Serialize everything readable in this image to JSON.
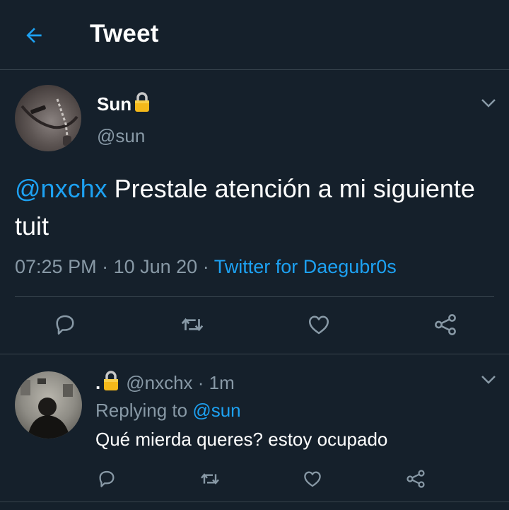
{
  "header": {
    "title": "Tweet",
    "back_icon": "arrow-left-icon"
  },
  "colors": {
    "background": "#15202b",
    "accent": "#1da1f2",
    "muted": "#8899a6",
    "divider": "#38444d"
  },
  "tweet": {
    "name": "Sun",
    "handle": "@sun",
    "mention": "@nxchx",
    "text": " Prestale atención a mi siguiente tuit",
    "time": "07:25 PM",
    "date": "10 Jun 20",
    "source": "Twitter for Daegubr0s",
    "sep": " · "
  },
  "reply": {
    "name": ".",
    "handle": "@nxchx",
    "time": "1m",
    "sep": " · ",
    "replying_label": "Replying to ",
    "replying_to": "@sun",
    "text": "Qué mierda queres? estoy ocupado"
  },
  "actions": [
    "reply-icon",
    "retweet-icon",
    "like-icon",
    "share-icon"
  ]
}
